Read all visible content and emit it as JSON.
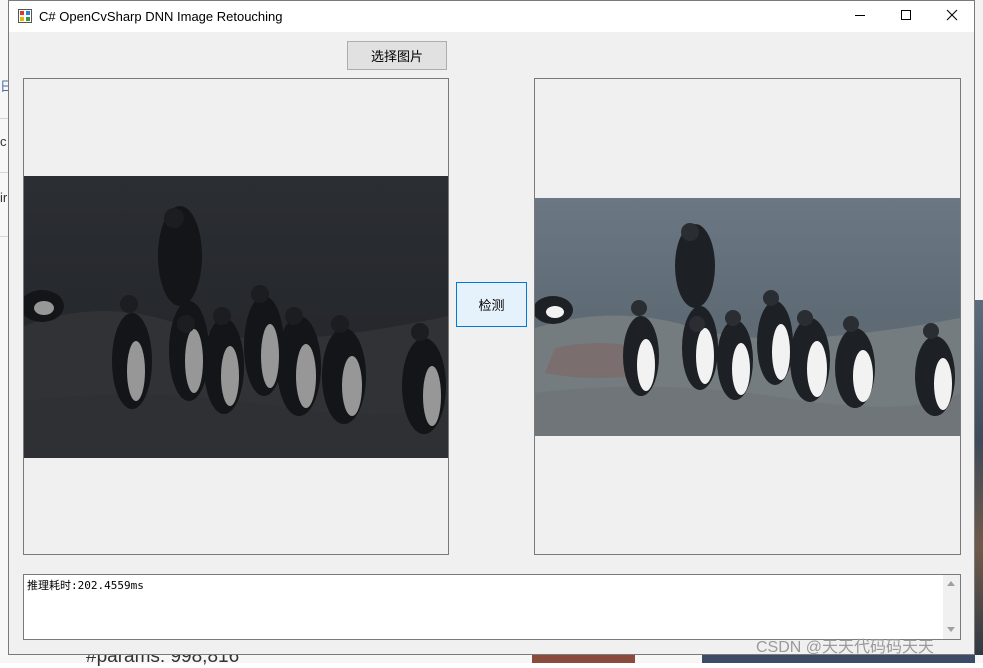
{
  "window": {
    "title": "C# OpenCvSharp DNN Image Retouching",
    "controls": {
      "minimize_icon": "minimize-icon",
      "maximize_icon": "maximize-icon",
      "close_icon": "close-icon"
    }
  },
  "toolbar": {
    "select_image_label": "选择图片",
    "detect_label": "检测"
  },
  "output": {
    "log_text": "推理耗时:202.4559ms"
  },
  "background": {
    "bottom_text": "#params: 998,816",
    "watermark": "CSDN @天天代码码天天"
  },
  "colors": {
    "accent_border": "#0078d7",
    "detect_button_bg": "#e5f1fb"
  }
}
